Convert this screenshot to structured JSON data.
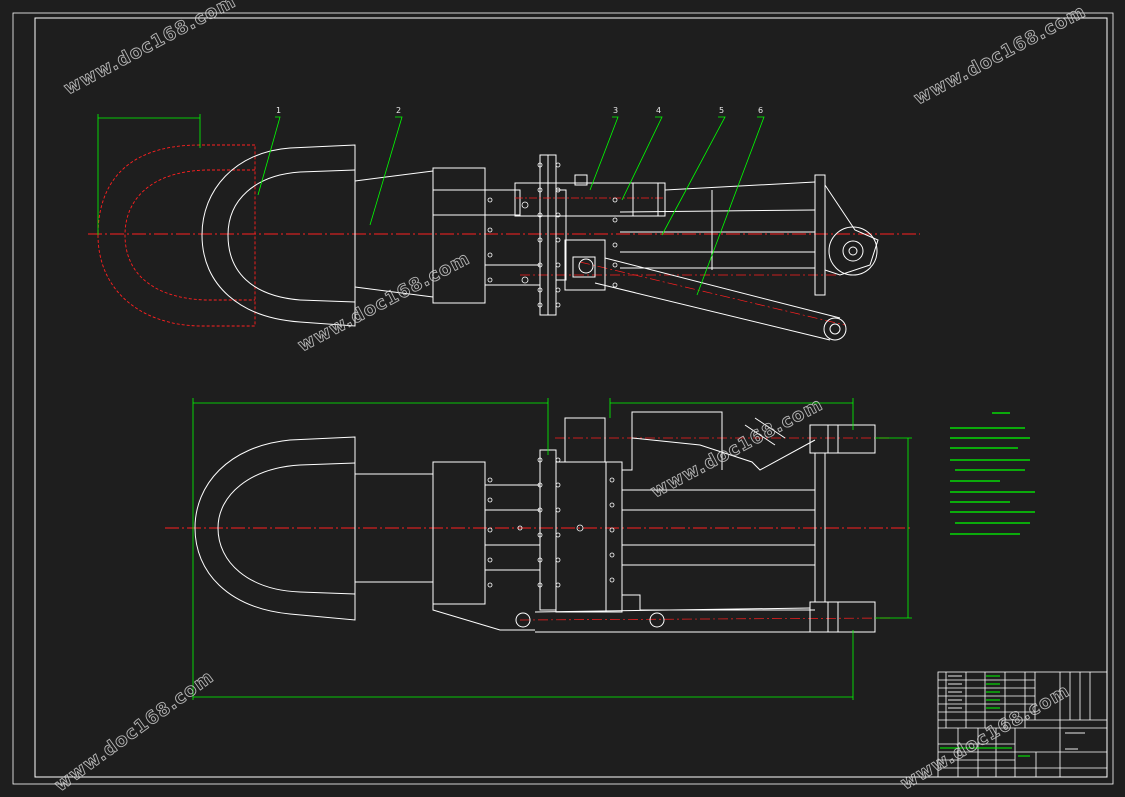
{
  "part_numbers": [
    "1",
    "2",
    "3",
    "4",
    "5",
    "6"
  ],
  "watermark_text": "www.doc168.com",
  "colors": {
    "background": "#1e1e1e",
    "outline": "#ffffff",
    "centerline": "#ff2020",
    "dimension": "#00ff00",
    "watermark": "#cfcfcf"
  }
}
